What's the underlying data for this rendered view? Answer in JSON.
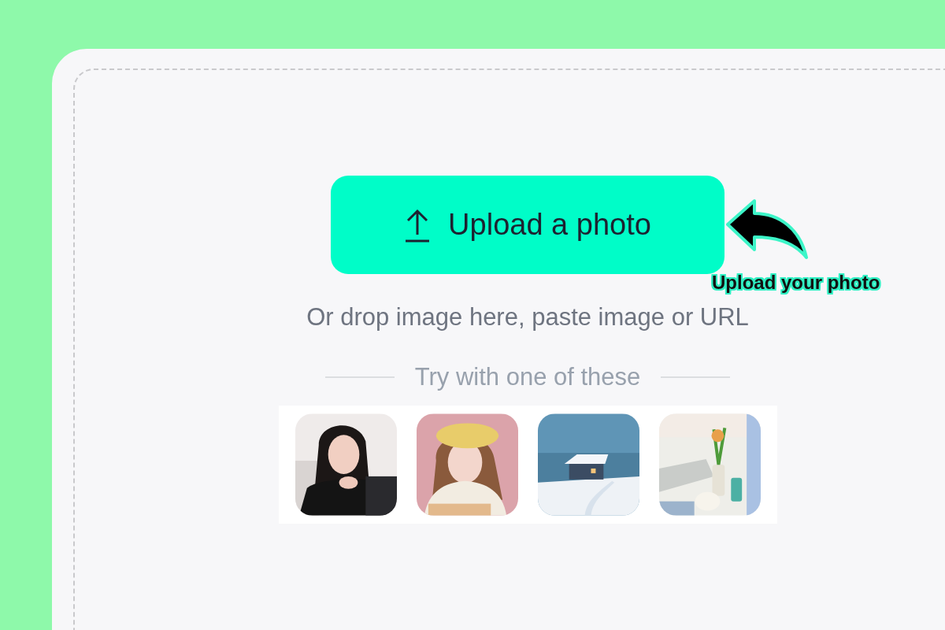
{
  "upload_button": {
    "label": "Upload a photo"
  },
  "annotation": {
    "label": "Upload your photo"
  },
  "hint": "Or drop image here, paste image or URL",
  "samples_heading": "Try with one of these"
}
